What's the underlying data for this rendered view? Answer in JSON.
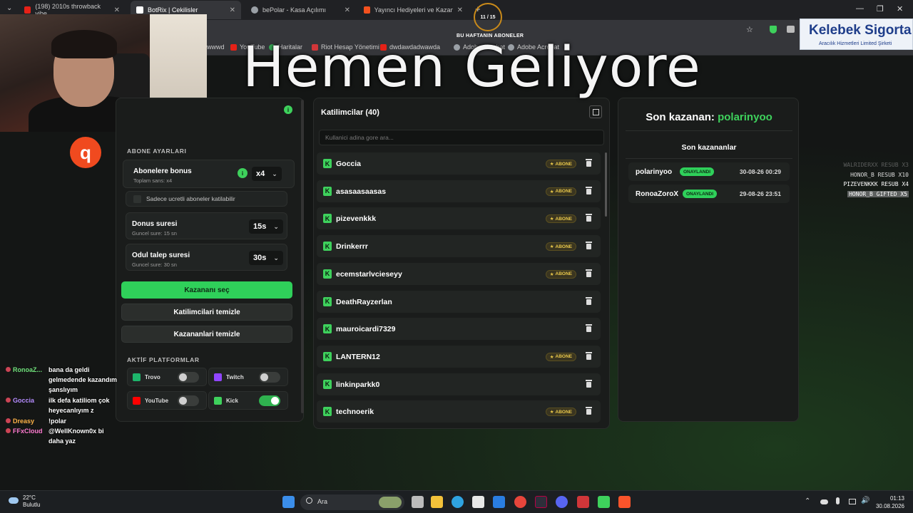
{
  "browser": {
    "tabs": [
      {
        "title": "(198) 2010s throwback vibe",
        "active": false,
        "color": "#e62117"
      },
      {
        "title": "BotRix | Cekilisler",
        "active": true,
        "color": "#ffffff"
      },
      {
        "title": "bePolar - Kasa Açılımı",
        "active": false,
        "color": "#9aa0a6"
      },
      {
        "title": "Yayıncı Hediyeleri ve Kazananlar",
        "active": false,
        "color": "#f4511e"
      }
    ],
    "new_tab": "+",
    "bookmarks": [
      "wwwd",
      "YouTube",
      "Haritalar",
      "Riot Hesap Yönetimi",
      "dwdawdadwawda",
      "Adobe Acrobat",
      "Adobe Acrobat"
    ]
  },
  "overlay": {
    "big_text": "Hemen Geliyore",
    "counter": "11 / 15",
    "counter_caption": "BU HAFTANIN ABONELER",
    "sponsor_title": "Kelebek Sigorta",
    "sponsor_sub": "Aracılık Hizmetleri Limited Şirketi",
    "logo_glyph": "q"
  },
  "settings": {
    "section_title": "ABONE AYARLARI",
    "bonus_label": "Abonelere bonus",
    "bonus_sub": "Toplam sans: x4",
    "bonus_value": "x4",
    "paid_only_label": "Sadece ucretli aboneler katilabilir",
    "duration_label": "Donus suresi",
    "duration_sub": "Guncel sure: 15 sn",
    "duration_value": "15s",
    "claim_label": "Odul talep suresi",
    "claim_sub": "Guncel sure: 30 sn",
    "claim_value": "30s",
    "pick_winner": "Kazananı seç",
    "clear_participants": "Katilimcilari temizle",
    "clear_winners": "Kazananlari temizle",
    "platforms_title": "AKTİF PLATFORMLAR",
    "platforms": [
      {
        "name": "Trovo",
        "on": false,
        "color": "#1db56b"
      },
      {
        "name": "Twitch",
        "on": false,
        "color": "#9146ff"
      },
      {
        "name": "YouTube",
        "on": false,
        "color": "#ff0000"
      },
      {
        "name": "Kick",
        "on": true,
        "color": "#3ed15c"
      }
    ]
  },
  "participants": {
    "title": "Katilimcilar (40)",
    "search_placeholder": "Kullanici adina gore ara...",
    "badge_label": "ABONE",
    "rows": [
      {
        "name": "Goccia",
        "sub": true
      },
      {
        "name": "asasaasaasas",
        "sub": true
      },
      {
        "name": "pizevenkkk",
        "sub": true
      },
      {
        "name": "Drinkerrr",
        "sub": true
      },
      {
        "name": "ecemstarlvcieseyy",
        "sub": true
      },
      {
        "name": "DeathRayzerlan",
        "sub": false
      },
      {
        "name": "mauroicardi7329",
        "sub": false
      },
      {
        "name": "LANTERN12",
        "sub": true
      },
      {
        "name": "linkinparkk0",
        "sub": false
      },
      {
        "name": "technoerik",
        "sub": true
      }
    ]
  },
  "winners": {
    "title_prefix": "Son kazanan:",
    "title_name": "polarinyoo",
    "list_title": "Son kazananlar",
    "status_label": "ONAYLANDI",
    "rows": [
      {
        "name": "polarinyoo",
        "date": "30-08-26 00:29"
      },
      {
        "name": "RonoaZoroX",
        "date": "29-08-26 23:51"
      }
    ]
  },
  "alerts": [
    {
      "text": "WALRIDERXX RESUB X3",
      "style": "dim"
    },
    {
      "text": "HONOR_B RESUB X10",
      "style": "normal"
    },
    {
      "text": "PIZEVENKKK RESUB X4",
      "style": "bright"
    },
    {
      "text": "HONOR_B GIFTED X5",
      "style": "hl"
    }
  ],
  "chat": [
    {
      "user": "RonoaZ...",
      "color": "#6fe07a",
      "msg": "bana da geldi gelmedende kazandım şanslıyım"
    },
    {
      "user": "Goccia",
      "color": "#b58cff",
      "msg": "ilk defa katiliom çok heyecanlıyım z"
    },
    {
      "user": "Dreasy",
      "color": "#ffb347",
      "msg": "!polar"
    },
    {
      "user": "FFxCloud",
      "color": "#ff7ad0",
      "msg": "@WellKnown0x bi daha yaz"
    }
  ],
  "taskbar": {
    "temp": "22°C",
    "weather": "Bulutlu",
    "search": "Ara",
    "time": "01:13",
    "date": "30.08.2026"
  }
}
